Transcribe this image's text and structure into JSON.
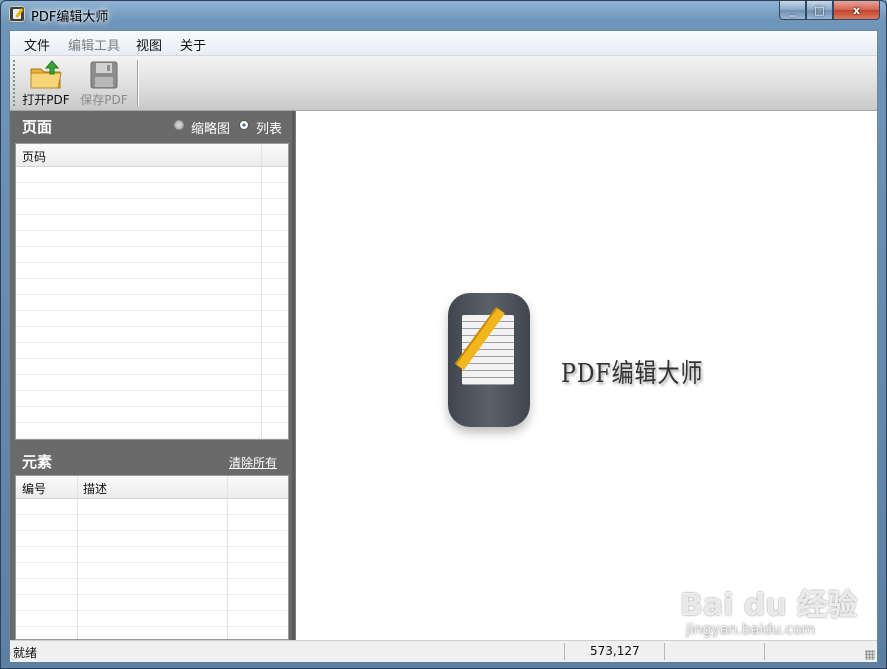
{
  "window": {
    "title": "PDF编辑大师",
    "controls": [
      "_",
      "□",
      "x"
    ]
  },
  "menubar": [
    {
      "label": "文件",
      "enabled": true
    },
    {
      "label": "编辑工具",
      "enabled": false
    },
    {
      "label": "视图",
      "enabled": true
    },
    {
      "label": "关于",
      "enabled": true
    }
  ],
  "toolbar": {
    "open_label": "打开PDF",
    "save_label": "保存PDF"
  },
  "pages_panel": {
    "title": "页面",
    "view_options": [
      {
        "label": "缩略图",
        "selected": false
      },
      {
        "label": "列表",
        "selected": true
      }
    ],
    "columns": [
      "页码"
    ]
  },
  "elements_panel": {
    "title": "元素",
    "clear_label": "清除所有",
    "columns": [
      "编号",
      "描述"
    ]
  },
  "canvas": {
    "logo_text": "PDF编辑大师"
  },
  "statusbar": {
    "status": "就绪",
    "coords": "573,127"
  },
  "watermark": {
    "brand": "Bai du 经验",
    "url": "jingyan.baidu.com"
  },
  "colors": {
    "panel_bg": "#6a6a6a",
    "accent_pencil": "#f2b51b",
    "logo_body": "#4a5058"
  }
}
